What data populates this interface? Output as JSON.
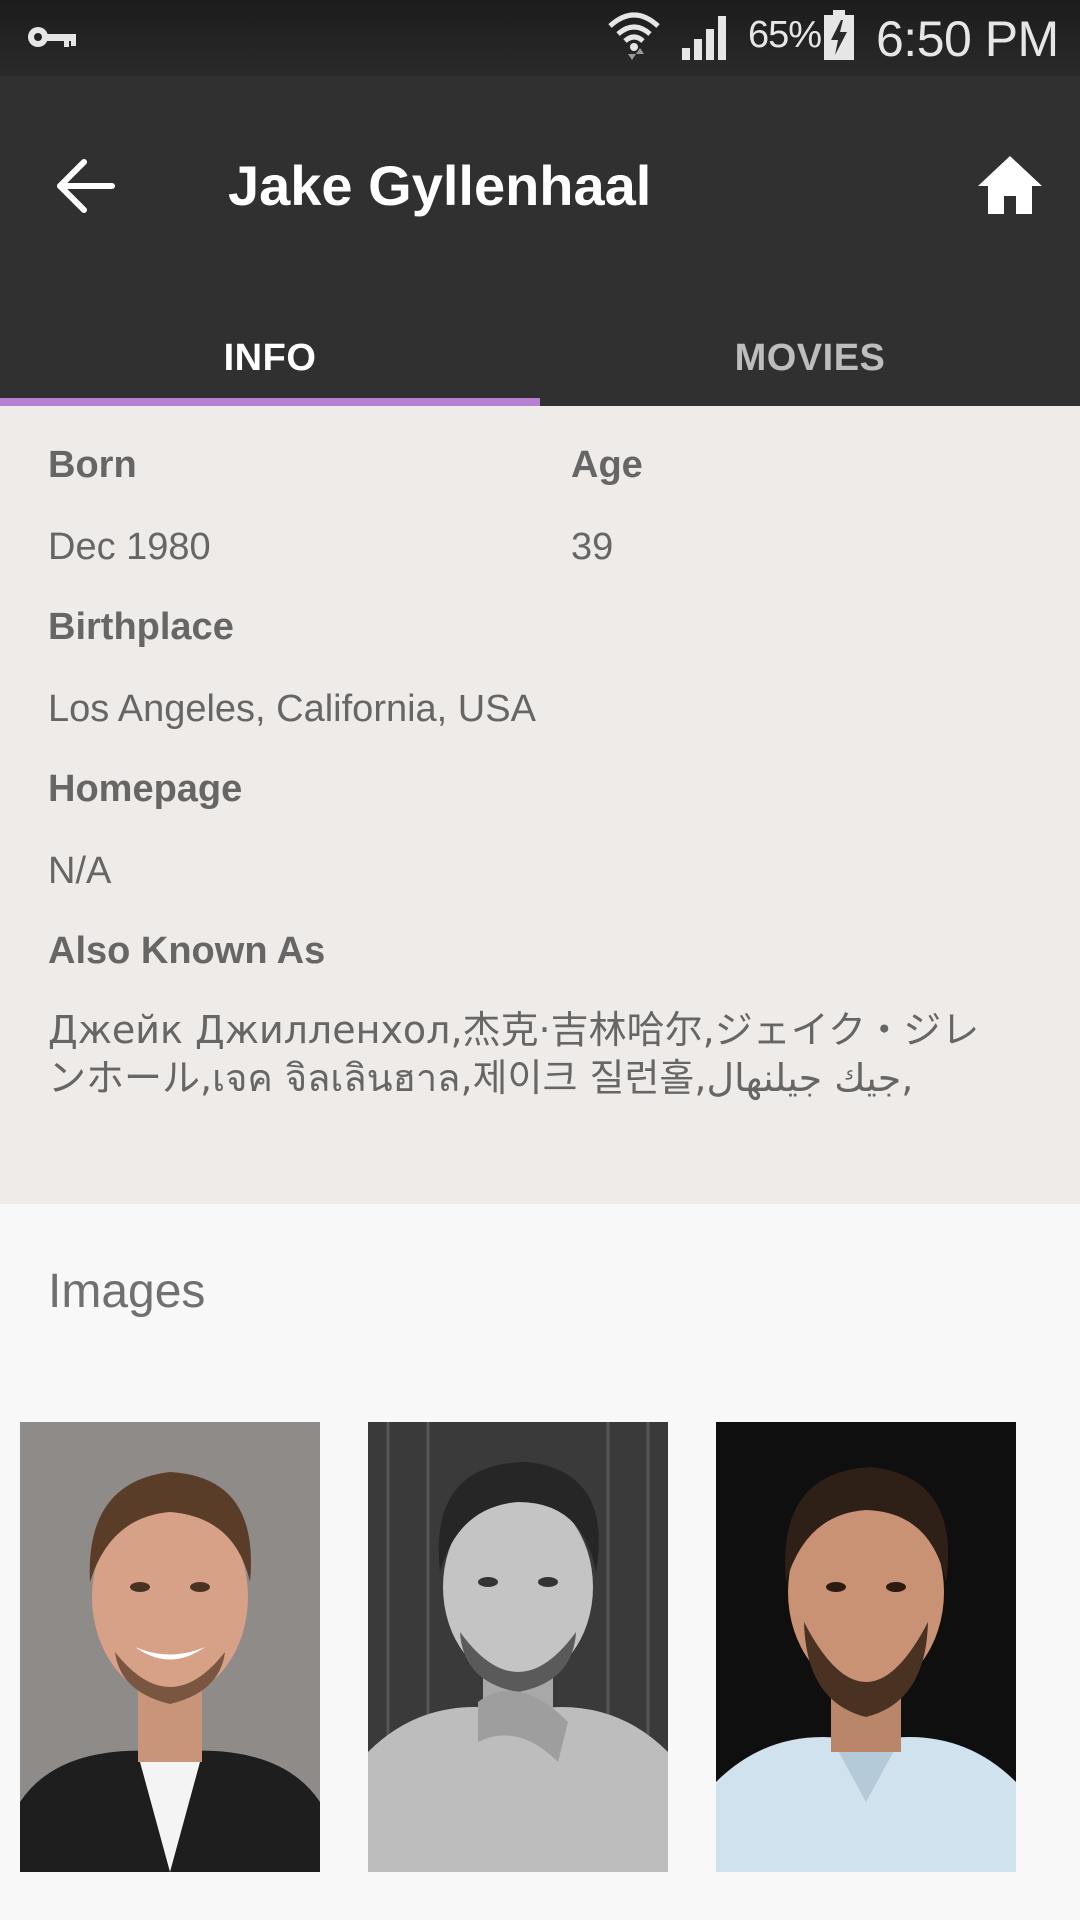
{
  "status_bar": {
    "battery_percent": "65%",
    "time": "6:50 PM"
  },
  "app_bar": {
    "title": "Jake Gyllenhaal",
    "back_icon": "arrow-back-icon",
    "home_icon": "home-icon"
  },
  "tabs": [
    {
      "label": "INFO",
      "active": true
    },
    {
      "label": "MOVIES",
      "active": false
    }
  ],
  "accent_color": "#b67fd2",
  "info": {
    "born_label": "Born",
    "born_value": "Dec 1980",
    "age_label": "Age",
    "age_value": "39",
    "birthplace_label": "Birthplace",
    "birthplace_value": "Los Angeles, California, USA",
    "homepage_label": "Homepage",
    "homepage_value": "N/A",
    "aka_label": "Also Known As",
    "aka_value": "Джейк Джилленхол,杰克·吉林哈尔,ジェイク・ジレンホール,เจค จิลเลินฮาล,제이크 질런홀,جيك جيلنهال,"
  },
  "images": {
    "heading": "Images",
    "photos": [
      {
        "alt": "photo-smiling-color"
      },
      {
        "alt": "photo-black-and-white"
      },
      {
        "alt": "photo-blue-shirt-color"
      }
    ]
  }
}
